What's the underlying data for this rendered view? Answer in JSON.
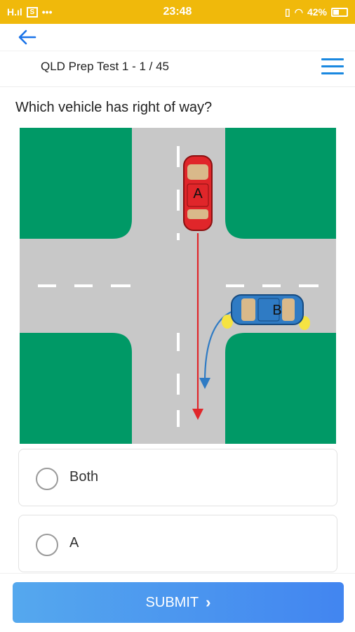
{
  "status_bar": {
    "signal": "H.ıl",
    "sim_icon": "S",
    "dots": "•••",
    "time": "23:48",
    "battery_percent": "42%",
    "battery_level": 0.42
  },
  "nav": {
    "back_icon": "arrow-left-icon"
  },
  "header": {
    "title": "QLD Prep Test 1 - 1 / 45",
    "menu_icon": "hamburger-menu-icon"
  },
  "question": {
    "text": "Which vehicle has right of way?"
  },
  "scene": {
    "car_a_label": "A",
    "car_b_label": "B",
    "colors": {
      "grass": "#009966",
      "road": "#c8c8c8",
      "car_a": "#e0262a",
      "car_b": "#2f7bc4",
      "arrow_a": "#e0262a",
      "arrow_b": "#2f7bc4",
      "indicator": "#f5e342"
    }
  },
  "options": [
    {
      "label": "Both"
    },
    {
      "label": "A"
    }
  ],
  "submit": {
    "label": "SUBMIT",
    "chevron": "›"
  },
  "colors": {
    "status_bar": "#f0b90b",
    "accent": "#1a73e8",
    "submit_gradient_start": "#55a8ee",
    "submit_gradient_end": "#4285f0"
  }
}
